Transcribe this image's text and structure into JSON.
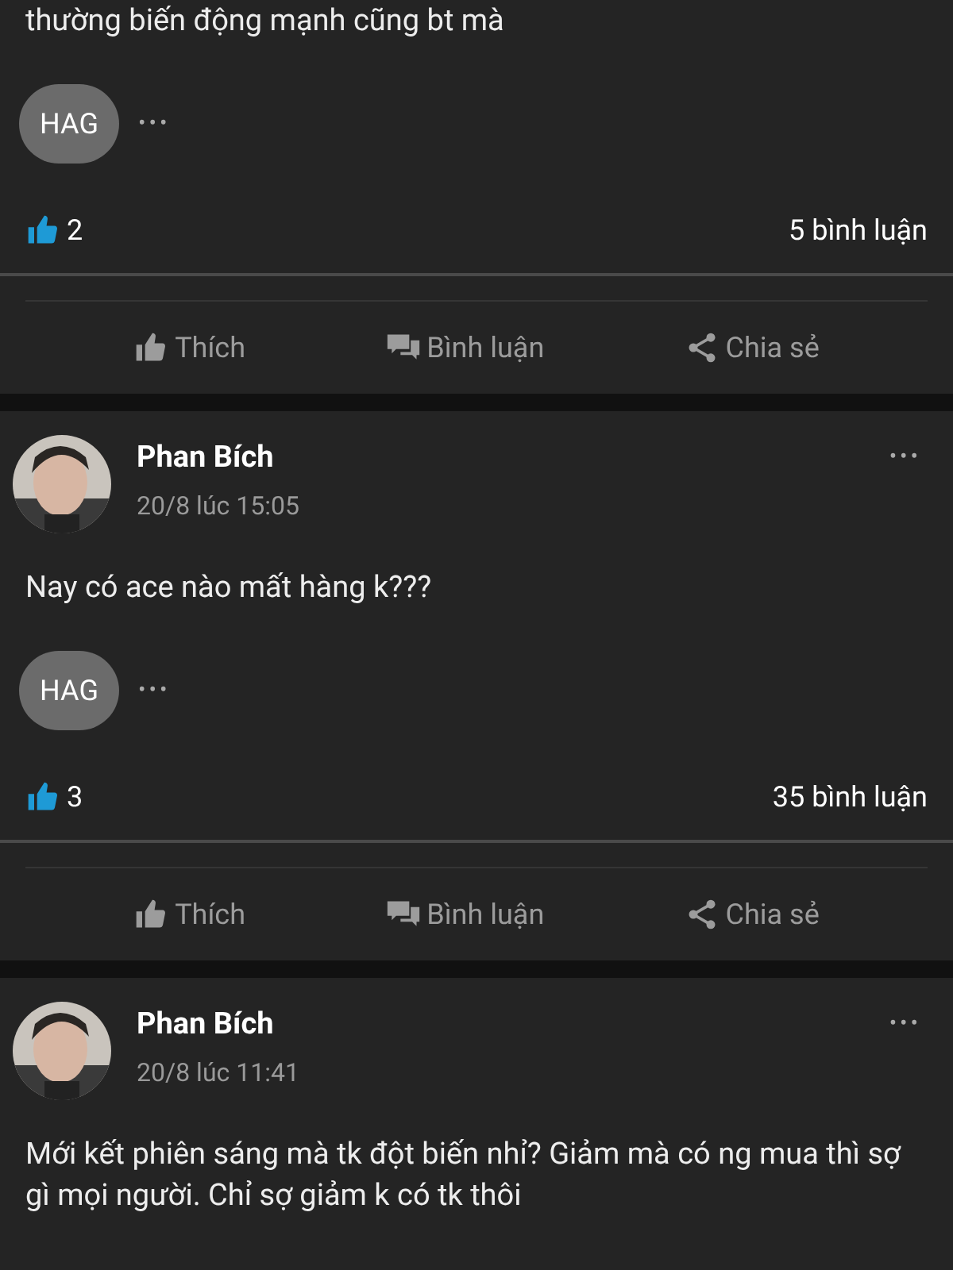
{
  "posts": [
    {
      "text": "thường biến động mạnh cũng bt mà",
      "reaction_chip": "HAG",
      "more": "•••",
      "likes": "2",
      "comments": "5 bình luận",
      "actions": [
        "Thích",
        "Bình luận",
        "Chia sẻ"
      ]
    },
    {
      "author": "Phan Bích",
      "time": "20/8 lúc 15:05",
      "menu": "•••",
      "text": "Nay có ace nào mất hàng k???",
      "reaction_chip": "HAG",
      "more": "•••",
      "likes": "3",
      "comments": "35 bình luận",
      "actions": [
        "Thích",
        "Bình luận",
        "Chia sẻ"
      ]
    },
    {
      "author": "Phan Bích",
      "time": "20/8 lúc 11:41",
      "menu": "•••",
      "text": "Mới kết phiên sáng mà tk đột biến nhỉ? Giảm mà có ng mua thì sợ gì mọi người. Chỉ sợ giảm k có tk thôi"
    }
  ]
}
